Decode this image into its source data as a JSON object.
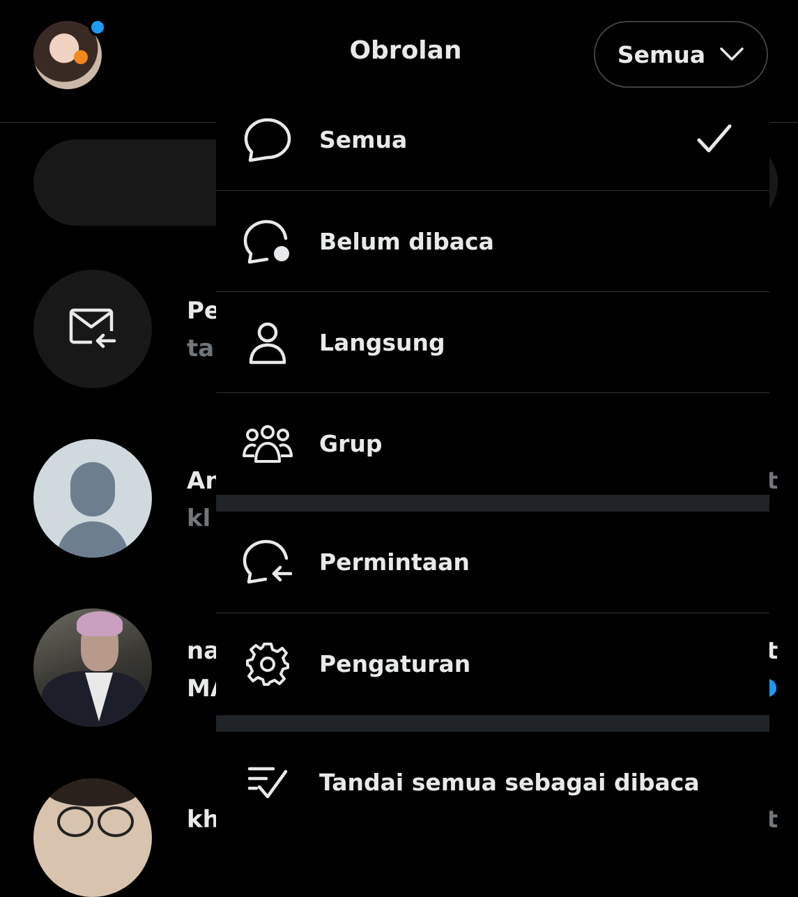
{
  "header": {
    "title": "Obrolan",
    "filter_label": "Semua"
  },
  "conversations_peek": [
    {
      "name": "Pe",
      "preview": "ta"
    },
    {
      "name": "An",
      "preview": "kl",
      "time": "t"
    },
    {
      "name": "na",
      "preview": "MA",
      "time": "t"
    },
    {
      "name": "kh",
      "time": "t"
    }
  ],
  "menu": {
    "items": [
      {
        "label": "Semua",
        "icon": "chat-bubble-icon",
        "selected": true
      },
      {
        "label": "Belum dibaca",
        "icon": "chat-bubble-unread-icon"
      },
      {
        "label": "Langsung",
        "icon": "person-icon"
      },
      {
        "label": "Grup",
        "icon": "group-icon"
      }
    ],
    "secondary": [
      {
        "label": "Permintaan",
        "icon": "chat-request-icon"
      },
      {
        "label": "Pengaturan",
        "icon": "gear-icon"
      }
    ],
    "action": {
      "label": "Tandai semua sebagai dibaca",
      "icon": "mark-read-icon"
    }
  },
  "colors": {
    "background": "#000000",
    "text": "#e7e9ea",
    "muted": "#71767b",
    "accent": "#1d9bf0",
    "divider": "#2f3336",
    "section_gap": "#202327"
  }
}
